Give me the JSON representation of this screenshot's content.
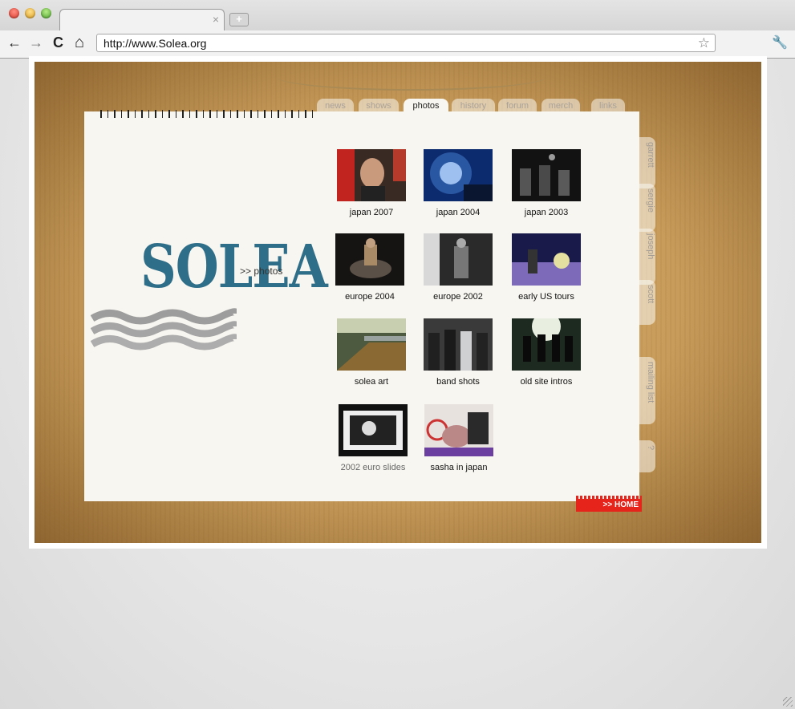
{
  "browser": {
    "tab_close": "×",
    "new_tab": "+",
    "back": "←",
    "forward": "→",
    "reload": "C",
    "home": "⌂",
    "url": "http://www.Solea.org",
    "star": "☆",
    "wrench": "🔧"
  },
  "site": {
    "logo": "SOLEA",
    "breadcrumb": ">> photos",
    "nav_tabs": [
      "news",
      "shows",
      "photos",
      "history",
      "forum",
      "merch",
      "links"
    ],
    "active_tab": "photos",
    "side_tabs": [
      "garrett",
      "sergie",
      "joseph",
      "scott",
      "mailing list",
      "?"
    ],
    "galleries": [
      {
        "caption": "japan 2007"
      },
      {
        "caption": "japan 2004"
      },
      {
        "caption": "japan 2003"
      },
      {
        "caption": "europe 2004"
      },
      {
        "caption": "europe 2002"
      },
      {
        "caption": "early US tours"
      },
      {
        "caption": "solea art"
      },
      {
        "caption": "band shots"
      },
      {
        "caption": "old site intros"
      },
      {
        "caption": "2002 euro slides"
      },
      {
        "caption": "sasha in japan"
      }
    ],
    "home_button": ">> HOME"
  }
}
